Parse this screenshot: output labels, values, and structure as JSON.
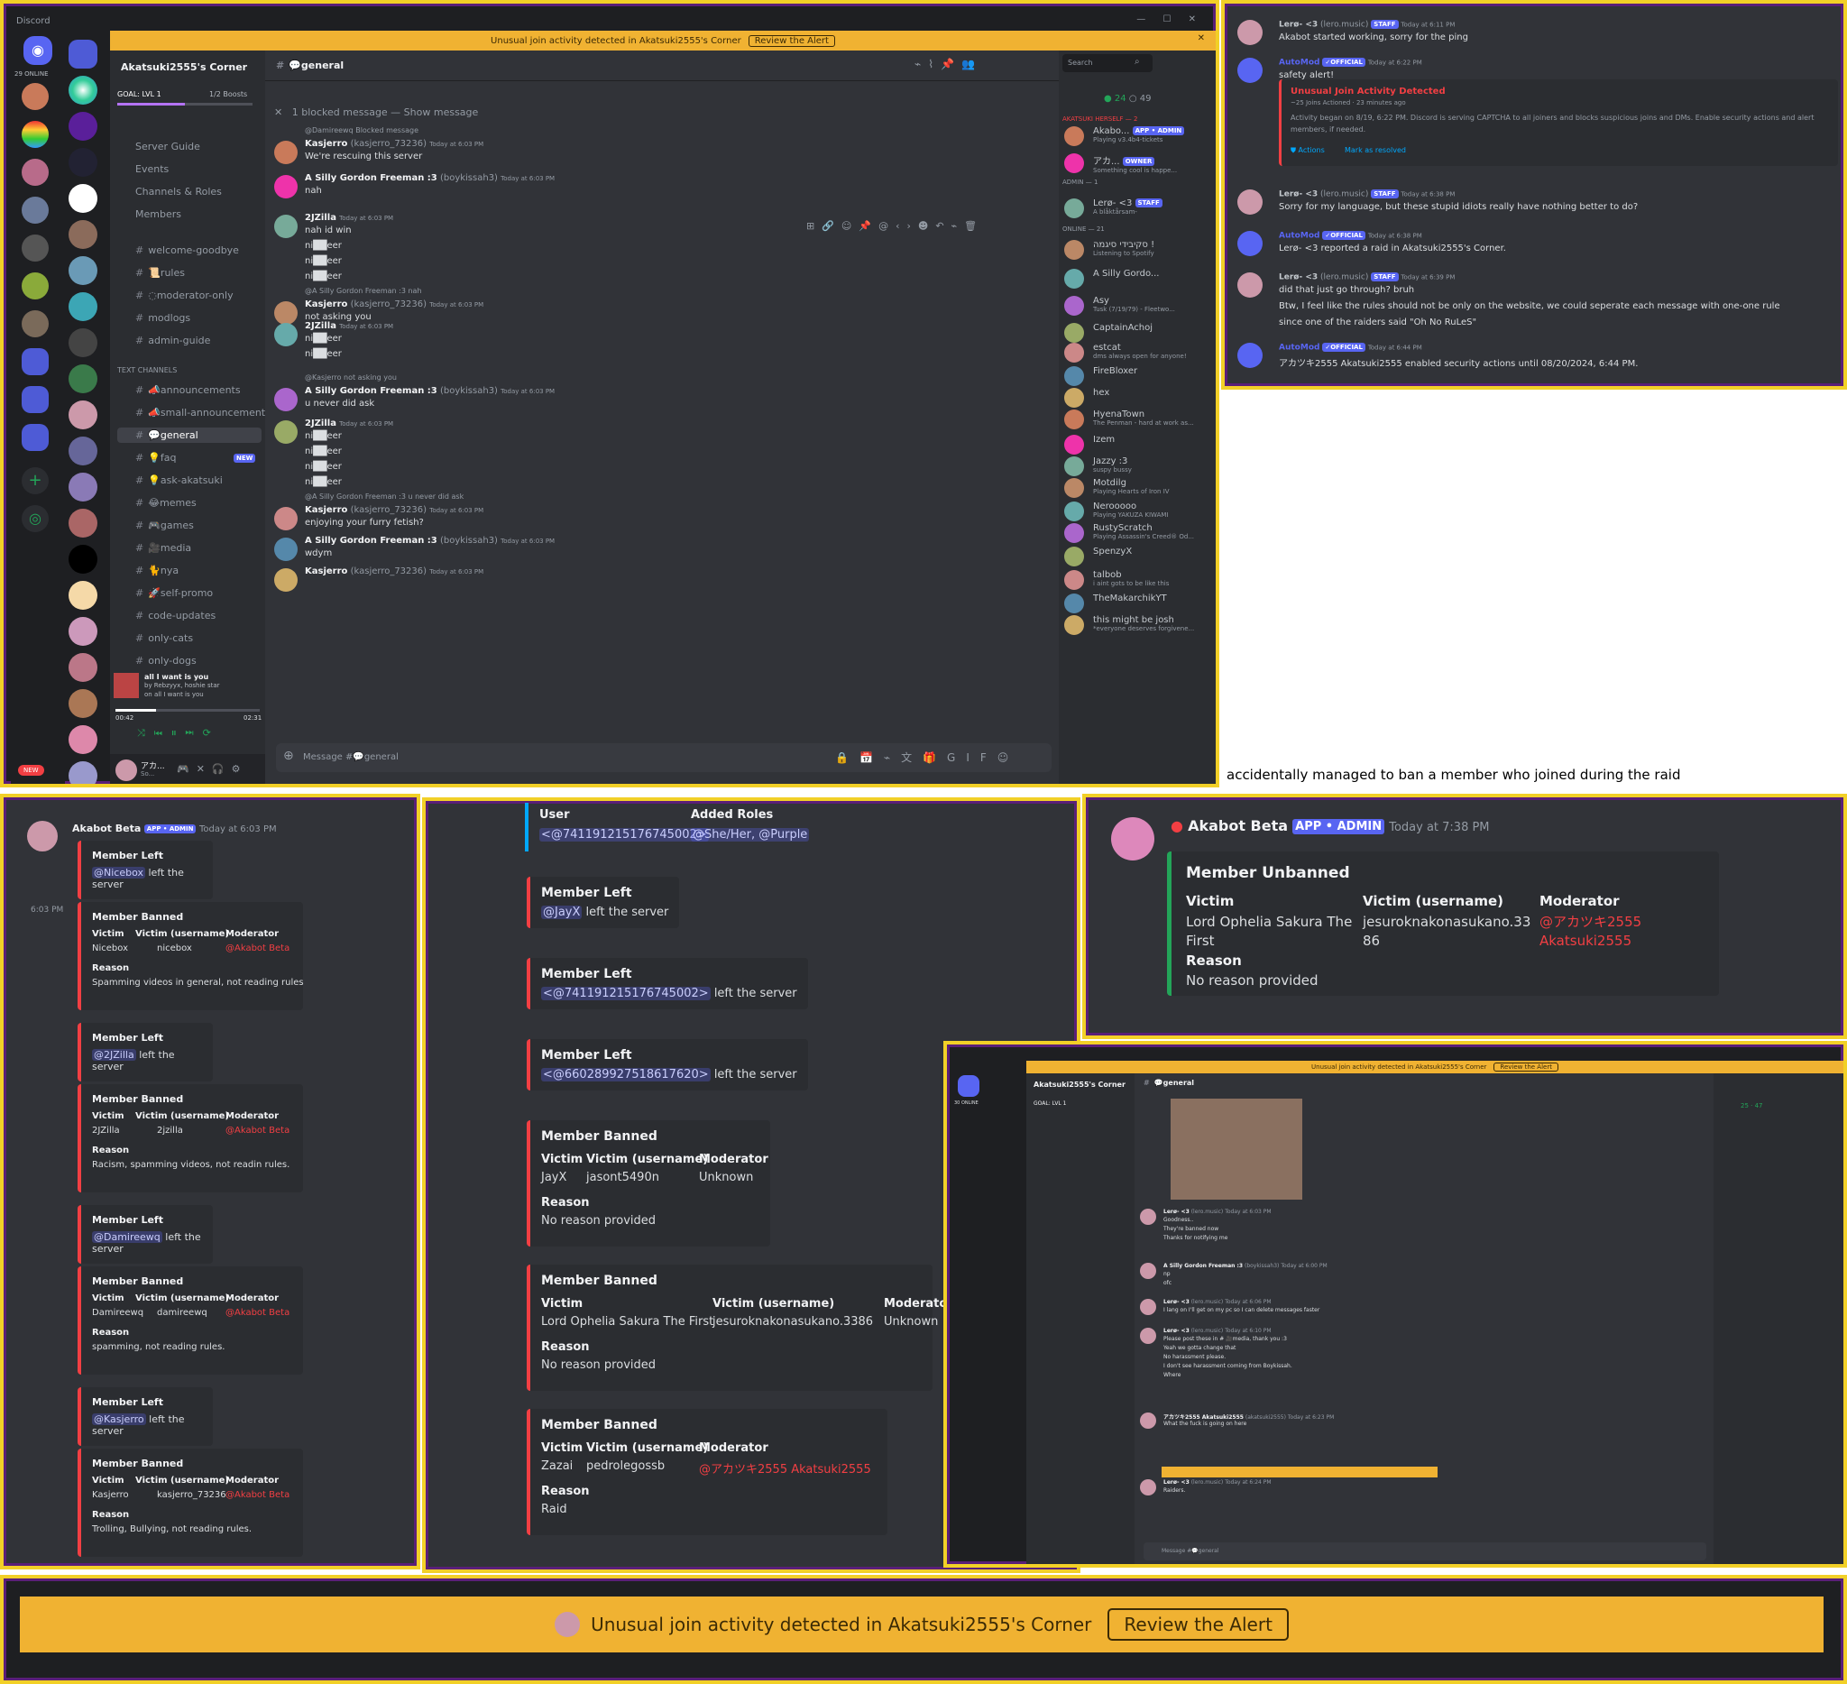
{
  "caption": "accidentally managed to ban a member who joined during the raid",
  "main": {
    "app": "Discord",
    "online": "29 ONLINE",
    "new": "NEW",
    "alert": "Unusual join activity detected in Akatsuki2555's Corner",
    "review": "Review the Alert",
    "server": "Akatsuki2555's Corner",
    "goal": "GOAL: LVL 1",
    "boosts": "1/2 Boosts",
    "nav": [
      "Server Guide",
      "Events",
      "Channels & Roles",
      "Members"
    ],
    "channels": [
      "welcome-goodbye",
      "📜rules",
      "◌moderator-only",
      "modlogs",
      "admin-guide"
    ],
    "text_channels": "TEXT CHANNELS",
    "channels2": [
      "📣announcements",
      "📣small-announcements",
      "💬general",
      "💡faq",
      "💡ask-akatsuki",
      "😂memes",
      "🎮games",
      "🎥media",
      "🐈nya",
      "🚀self-promo",
      "code-updates",
      "only-cats",
      "only-dogs"
    ],
    "new_badge": "NEW",
    "song": "all I want is you",
    "song_by": "by Rebzyyx, hoshie star",
    "song_on": "on all I want is you",
    "t0": "00:42",
    "t1": "02:31",
    "user": "アカ...",
    "user_sub": "So...",
    "channel": "💬general",
    "search": "Search",
    "online_count": "24",
    "offline_count": "49",
    "blocked": "1 blocked message — Show message",
    "input": "Message #💬general",
    "msgs": [
      {
        "reply": "@Damireewq Blocked message",
        "name": "Kasjerro",
        "user": "(kasjerro_73236)",
        "time": "Today at 6:03 PM",
        "lines": [
          "We're rescuing this server"
        ]
      },
      {
        "name": "A Silly Gordon Freeman :3",
        "user": "(boykissah3)",
        "time": "Today at 6:03 PM",
        "lines": [
          "nah"
        ]
      },
      {
        "name": "2JZilla",
        "time": "Today at 6:03 PM",
        "lines": [
          "nah id win",
          "ni██eer",
          "ni██eer",
          "ni██eer"
        ]
      },
      {
        "reply": "@A Silly Gordon Freeman :3 nah",
        "name": "Kasjerro",
        "user": "(kasjerro_73236)",
        "time": "Today at 6:03 PM",
        "lines": [
          "not asking you"
        ]
      },
      {
        "name": "2JZilla",
        "time": "Today at 6:03 PM",
        "lines": [
          "ni██eer",
          "ni██eer"
        ]
      },
      {
        "reply": "@Kasjerro not asking you",
        "name": "A Silly Gordon Freeman :3",
        "user": "(boykissah3)",
        "time": "Today at 6:03 PM",
        "lines": [
          "u never did ask"
        ]
      },
      {
        "name": "2JZilla",
        "time": "Today at 6:03 PM",
        "lines": [
          "ni██eer",
          "ni██eer",
          "ni██eer",
          "ni██eer"
        ]
      },
      {
        "reply": "@A Silly Gordon Freeman :3 u never did ask",
        "name": "Kasjerro",
        "user": "(kasjerro_73236)",
        "time": "Today at 6:03 PM",
        "lines": [
          "enjoying your furry fetish?"
        ]
      },
      {
        "name": "A Silly Gordon Freeman :3",
        "user": "(boykissah3)",
        "time": "Today at 6:03 PM",
        "lines": [
          "wdym"
        ]
      },
      {
        "name": "Kasjerro",
        "user": "(kasjerro_73236)",
        "time": "Today at 6:03 PM",
        "lines": [
          ""
        ]
      }
    ],
    "groups": [
      "AKATSUKI HERSELF — 2",
      "ADMIN — 1",
      "ONLINE — 21"
    ],
    "members": [
      {
        "n": "Akabo...",
        "s": "Playing v3.4b4-tickets",
        "tag": "APP • ADMIN"
      },
      {
        "n": "アカ...",
        "s": "Something cool is happe...",
        "tag": "OWNER"
      },
      {
        "n": "Lerø- <3",
        "s": "A blåktårsam-",
        "tag": "STAFF"
      },
      {
        "n": "סקיבידי סיגמה !",
        "s": "Listening to Spotify"
      },
      {
        "n": "A Silly Gordo...",
        "s": ""
      },
      {
        "n": "Asy",
        "s": "Tusk (7/19/79) - Fleetwo..."
      },
      {
        "n": "CaptainAchoj",
        "s": ""
      },
      {
        "n": "estcat",
        "s": "dms always open for anyone!"
      },
      {
        "n": "FireBloxer",
        "s": ""
      },
      {
        "n": "hex",
        "s": ""
      },
      {
        "n": "HyenaTown",
        "s": "The Penman - hard at work as..."
      },
      {
        "n": "Izem",
        "s": ""
      },
      {
        "n": "Jazzy :3",
        "s": "suspy bussy"
      },
      {
        "n": "Motdilg",
        "s": "Playing Hearts of Iron IV"
      },
      {
        "n": "Nerooooo",
        "s": "Playing YAKUZA KIWAMI"
      },
      {
        "n": "RustyScratch",
        "s": "Playing Assassin's Creed® Od..."
      },
      {
        "n": "SpenzyX",
        "s": ""
      },
      {
        "n": "talbob",
        "s": "i aint gots to be like this"
      },
      {
        "n": "TheMakarchikYT",
        "s": ""
      },
      {
        "n": "this might be josh",
        "s": "*everyone deserves forgivene..."
      }
    ]
  },
  "top_right": {
    "msgs": [
      {
        "name": "Lerø- <3",
        "user": "(lero.music)",
        "tag": "STAFF",
        "time": "Today at 6:11 PM",
        "text": "Akabot started working, sorry for the ping"
      },
      {
        "name": "AutoMod",
        "tag": "✓OFFICIAL",
        "time": "Today at 6:22 PM",
        "text": "safety alert!"
      },
      {
        "name": "Lerø- <3",
        "user": "(lero.music)",
        "tag": "STAFF",
        "time": "Today at 6:38 PM",
        "text": "Sorry for my language, but these stupid idiots really have nothing better to do?"
      },
      {
        "name": "AutoMod",
        "tag": "✓OFFICIAL",
        "time": "Today at 6:38 PM",
        "text": "Lerø- <3 reported a raid in Akatsuki2555's Corner."
      },
      {
        "name": "Lerø- <3",
        "user": "(lero.music)",
        "tag": "STAFF",
        "time": "Today at 6:39 PM",
        "text": "did that just go through? bruh"
      },
      {
        "name": "AutoMod",
        "tag": "✓OFFICIAL",
        "time": "Today at 6:44 PM",
        "text": "アカツキ2555 Akatsuki2555 enabled security actions until 08/20/2024, 6:44 PM."
      }
    ],
    "alert_title": "Unusual Join Activity Detected",
    "alert_meta": "~25 Joins Actioned · 23 minutes ago",
    "alert_body": "Activity began on 8/19, 6:22 PM. Discord is serving CAPTCHA to all joiners and blocks suspicious joins and DMs. Enable security actions and alert members, if needed.",
    "actions": "Actions",
    "resolved": "Mark as resolved",
    "cont1": "Btw, I feel like the rules should not be only on the website, we could seperate each message with one-one rule",
    "cont2": "since one of the raiders said \"Oh No RuLeS\""
  },
  "bot": {
    "name": "Akabot Beta",
    "tag": "APP • ADMIN",
    "time": "Today at 6:03 PM",
    "side_time": "6:03 PM",
    "left": "Member Left",
    "banned": "Member Banned",
    "lbl_victim": "Victim",
    "lbl_vu": "Victim (username)",
    "lbl_mod": "Moderator",
    "lbl_reason": "Reason",
    "left_suffix": "left the server",
    "e": [
      {
        "m": "@Nicebox"
      },
      {
        "v": "Nicebox",
        "u": "nicebox",
        "mod": "@Akabot Beta",
        "r": "Spamming videos in general, not reading rules"
      },
      {
        "m": "@2JZilla"
      },
      {
        "v": "2JZilla",
        "u": "2jzilla",
        "mod": "@Akabot Beta",
        "r": "Racism, spamming videos, not readin rules."
      },
      {
        "m": "@Damireewq"
      },
      {
        "v": "Damireewq",
        "u": "damireewq",
        "mod": "@Akabot Beta",
        "r": "spamming, not reading rules."
      },
      {
        "m": "@Kasjerro"
      },
      {
        "v": "Kasjerro",
        "u": "kasjerro_73236",
        "mod": "@Akabot Beta",
        "r": "Trolling, Bullying, not reading rules."
      }
    ]
  },
  "mid": {
    "user_lbl": "User",
    "roles_lbl": "Added Roles",
    "user_val": "<@741191215176745002>",
    "roles": "@She/Her, @Purple",
    "l1": "@JayX",
    "l2": "<@741191215176745002>",
    "l3": "<@660289927518617620>",
    "b1": {
      "v": "JayX",
      "u": "jasont5490n",
      "mod": "Unknown",
      "r": "No reason provided"
    },
    "b2": {
      "v": "Lord Ophelia Sakura The First",
      "u": "jesuroknakonasukano.3386",
      "mod": "Unknown",
      "r": "No reason provided"
    },
    "b3": {
      "v": "Zazai",
      "u": "pedrolegossb",
      "mod": "@アカツキ2555 Akatsuki2555",
      "r": "Raid"
    }
  },
  "unban": {
    "name": "Akabot Beta",
    "tag": "APP • ADMIN",
    "time": "Today at 7:38 PM",
    "title": "Member Unbanned",
    "v": "Lord Ophelia Sakura The First",
    "u": "jesuroknakonasukano.3386",
    "mod": "@アカツキ2555 Akatsuki2555",
    "r": "No reason provided"
  },
  "small": {
    "msgs": [
      {
        "name": "Lerø- <3",
        "user": "(lero.music)",
        "time": "Today at 6:03 PM",
        "lines": [
          "Goodness..",
          "They're banned now",
          "Thanks for notifying me"
        ]
      },
      {
        "name": "A Silly Gordon Freeman :3",
        "user": "(boykissah3)",
        "time": "Today at 6:00 PM",
        "lines": [
          "np",
          "ofc"
        ]
      },
      {
        "name": "Lerø- <3",
        "user": "(lero.music)",
        "time": "Today at 6:06 PM",
        "lines": [
          "I lang on I'll get on my pc so I can delete messages faster"
        ]
      },
      {
        "name": "Lerø- <3",
        "user": "(lero.music)",
        "time": "Today at 6:10 PM",
        "lines": [
          "Please post these in # 🎥media, thank you :3",
          "Yeah we gotta change that",
          "No harassment please.",
          "I don't see harassment coming from Boykissah.",
          "Where"
        ]
      },
      {
        "name": "アカツキ2555 Akatsuki2555",
        "user": "(akatsuki2555)",
        "time": "Today at 6:23 PM",
        "lines": [
          "What the fuck is going on here"
        ]
      },
      {
        "name": "Lerø- <3",
        "user": "(lero.music)",
        "time": "Today at 6:24 PM",
        "lines": [
          "Raiders."
        ]
      }
    ],
    "online": "30 ONLINE",
    "counts": "25 · 47"
  },
  "banner": {
    "text": "Unusual join activity detected in Akatsuki2555's Corner",
    "btn": "Review the Alert"
  },
  "colors": {
    "bg": "#313338",
    "side": "#2b2d31",
    "rail": "#1e1f22",
    "alert": "#f0b232",
    "border": "#f2d027",
    "purple": "#5a1f78",
    "blurple": "#5865f2",
    "red": "#f23f43"
  }
}
